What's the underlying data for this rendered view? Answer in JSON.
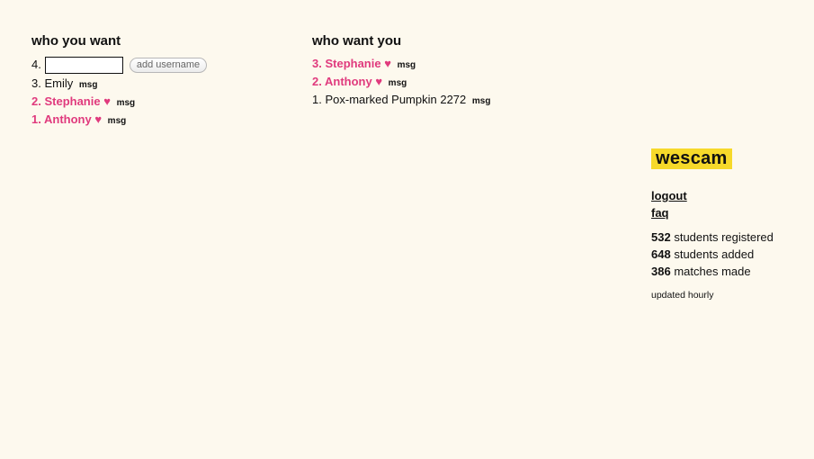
{
  "who_you_want": {
    "heading": "who you want",
    "add_row": {
      "number": "4.",
      "input_value": "",
      "input_placeholder": "",
      "button_label": "add username"
    },
    "entries": [
      {
        "number": "3.",
        "name": "Emily",
        "heart": "",
        "msg": "msg",
        "matched": false
      },
      {
        "number": "2.",
        "name": "Stephanie",
        "heart": "♥",
        "msg": "msg",
        "matched": true
      },
      {
        "number": "1.",
        "name": "Anthony",
        "heart": "♥",
        "msg": "msg",
        "matched": true
      }
    ]
  },
  "who_want_you": {
    "heading": "who want you",
    "entries": [
      {
        "number": "3.",
        "name": "Stephanie",
        "heart": "♥",
        "msg": "msg",
        "matched": true
      },
      {
        "number": "2.",
        "name": "Anthony",
        "heart": "♥",
        "msg": "msg",
        "matched": true
      },
      {
        "number": "1.",
        "name": "Pox-marked Pumpkin 2272",
        "heart": "",
        "msg": "msg",
        "matched": false
      }
    ]
  },
  "sidebar": {
    "logo": "wescam",
    "links": {
      "logout": "logout",
      "faq": "faq"
    },
    "stats": [
      {
        "count": "532",
        "label": "students registered"
      },
      {
        "count": "648",
        "label": "students added"
      },
      {
        "count": "386",
        "label": "matches made"
      }
    ],
    "updated_note": "updated hourly"
  },
  "colors": {
    "background": "#fdf9ee",
    "match_pink": "#e03a7d",
    "logo_yellow": "#f6d92a"
  }
}
